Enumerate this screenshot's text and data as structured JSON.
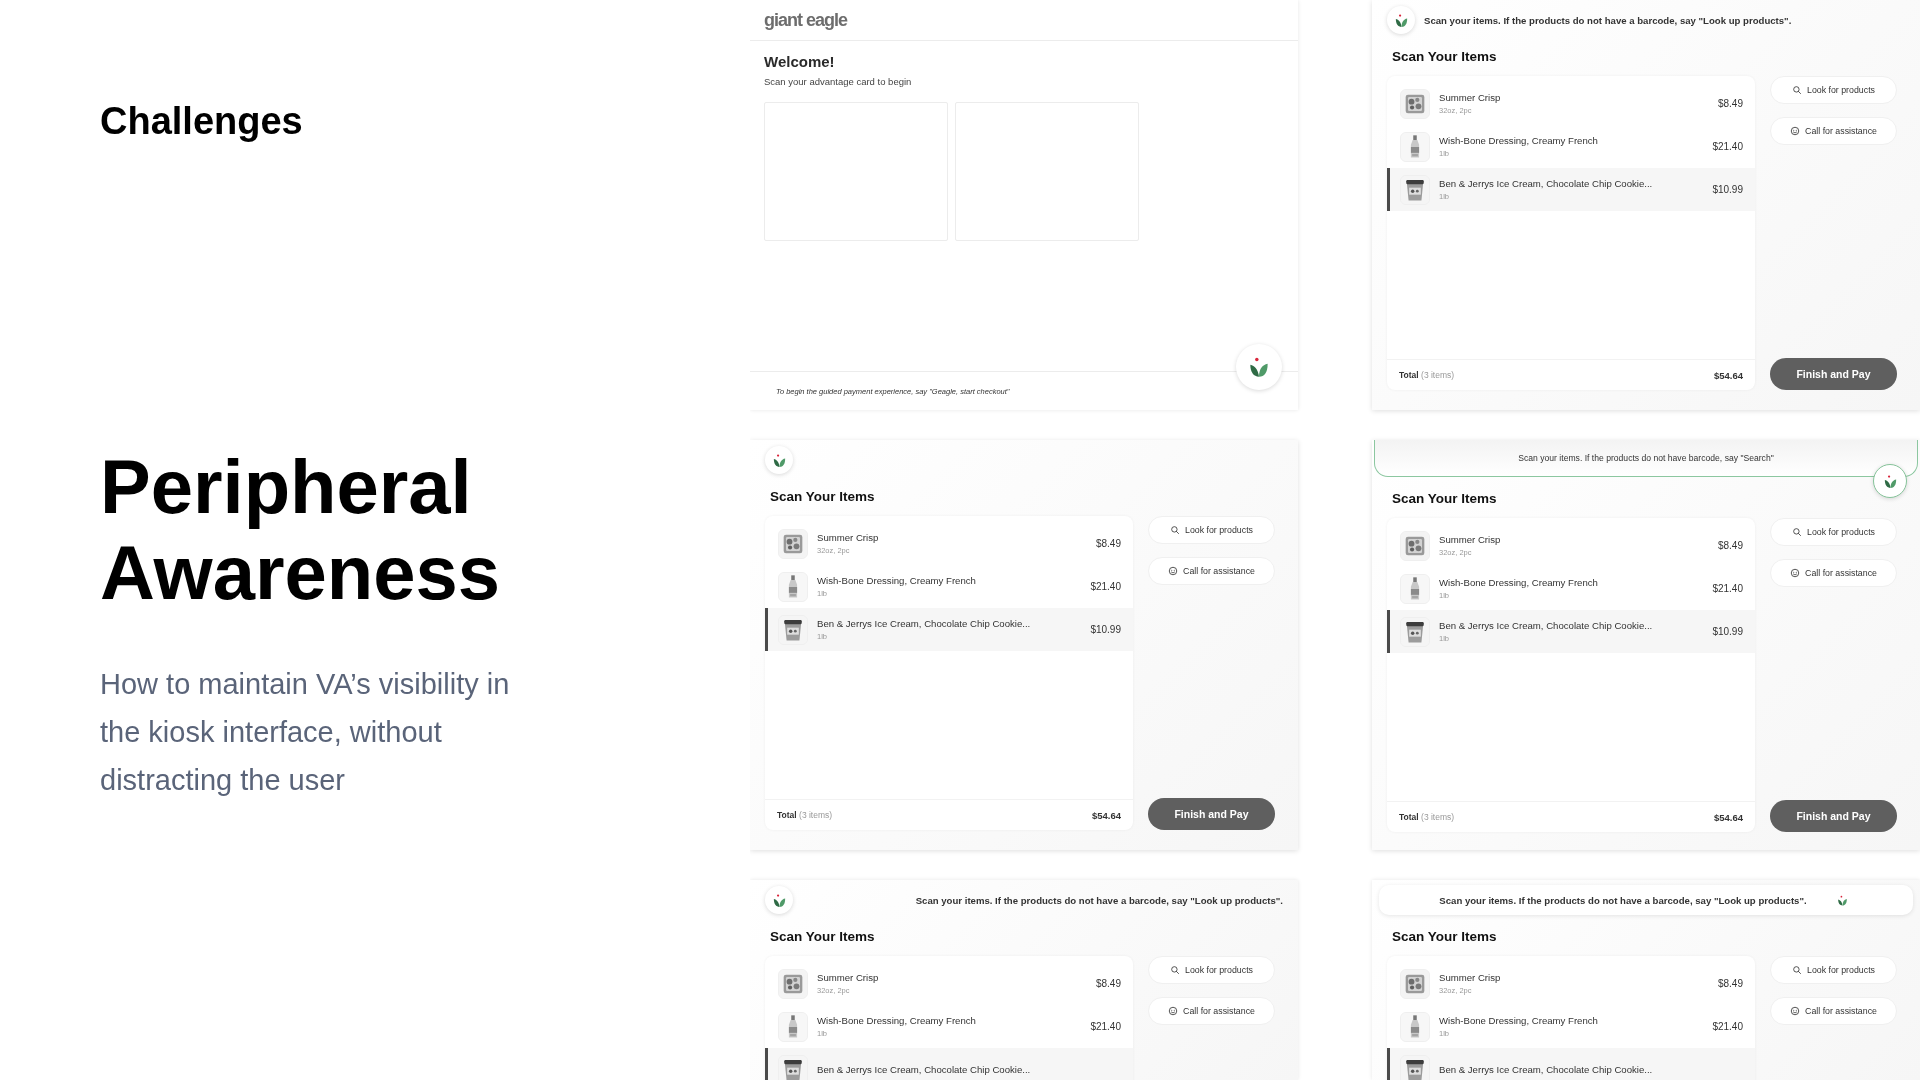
{
  "section_label": "Challenges",
  "title": "Peripheral Awareness",
  "description": "How to maintain VA’s visibility in the kiosk interface, without distracting the user",
  "screens": [
    {
      "kind": "welcome",
      "logo": "giant eagle",
      "heading": "Welcome!",
      "subheading": "Scan your advantage card to begin",
      "footer": "To begin the guided payment experience, say \"Geagle, start checkout\""
    },
    {
      "kind": "scan",
      "assistant": {
        "kind": "inline_left",
        "message": "Scan your items. If the products do not have a barcode, say \"Look up products\"."
      },
      "title": "Scan Your Items",
      "items": [
        {
          "name": "Summer Crisp",
          "detail": "32oz, 2pc",
          "price": "$8.49",
          "selected": false
        },
        {
          "name": "Wish-Bone Dressing, Creamy French",
          "detail": "1lb",
          "price": "$21.40",
          "selected": false
        },
        {
          "name": "Ben & Jerrys Ice Cream, Chocolate Chip Cookie...",
          "detail": "1lb",
          "price": "$10.99",
          "selected": true
        }
      ],
      "total": {
        "label": "Total",
        "count": "(3 items)",
        "amount": "$54.64"
      },
      "actions": [
        {
          "kind": "search",
          "label": "Look for products"
        },
        {
          "kind": "assist",
          "label": "Call for assistance"
        }
      ],
      "primary": "Finish and Pay"
    },
    {
      "kind": "scan",
      "assistant": {
        "kind": "icon_only"
      },
      "title": "Scan Your Items",
      "items": [
        {
          "name": "Summer Crisp",
          "detail": "32oz, 2pc",
          "price": "$8.49",
          "selected": false
        },
        {
          "name": "Wish-Bone Dressing, Creamy French",
          "detail": "1lb",
          "price": "$21.40",
          "selected": false
        },
        {
          "name": "Ben & Jerrys Ice Cream, Chocolate Chip Cookie...",
          "detail": "1lb",
          "price": "$10.99",
          "selected": true
        }
      ],
      "total": {
        "label": "Total",
        "count": "(3 items)",
        "amount": "$54.64"
      },
      "actions": [
        {
          "kind": "search",
          "label": "Look for products"
        },
        {
          "kind": "assist",
          "label": "Call for assistance"
        }
      ],
      "primary": "Finish and Pay"
    },
    {
      "kind": "scan",
      "assistant": {
        "kind": "bubble_right",
        "message": "Scan your items. If the products do not have barcode, say \"Search\""
      },
      "title": "Scan Your Items",
      "items": [
        {
          "name": "Summer Crisp",
          "detail": "32oz, 2pc",
          "price": "$8.49",
          "selected": false
        },
        {
          "name": "Wish-Bone Dressing, Creamy French",
          "detail": "1lb",
          "price": "$21.40",
          "selected": false
        },
        {
          "name": "Ben & Jerrys Ice Cream, Chocolate Chip Cookie...",
          "detail": "1lb",
          "price": "$10.99",
          "selected": true
        }
      ],
      "total": {
        "label": "Total",
        "count": "(3 items)",
        "amount": "$54.64"
      },
      "actions": [
        {
          "kind": "search",
          "label": "Look for products"
        },
        {
          "kind": "assist",
          "label": "Call for assistance"
        }
      ],
      "primary": "Finish and Pay"
    },
    {
      "kind": "scan",
      "assistant": {
        "kind": "split",
        "message": "Scan your items. If the products do not have a barcode, say \"Look up products\"."
      },
      "title": "Scan Your Items",
      "items": [
        {
          "name": "Summer Crisp",
          "detail": "32oz, 2pc",
          "price": "$8.49",
          "selected": false
        },
        {
          "name": "Wish-Bone Dressing, Creamy French",
          "detail": "1lb",
          "price": "$21.40",
          "selected": false
        },
        {
          "name": "Ben & Jerrys Ice Cream, Chocolate Chip Cookie...",
          "selected": true
        }
      ],
      "actions": [
        {
          "kind": "search",
          "label": "Look for products"
        },
        {
          "kind": "assist",
          "label": "Call for assistance"
        }
      ]
    },
    {
      "kind": "scan",
      "assistant": {
        "kind": "bar_trailing",
        "message": "Scan your items. If the products do not have a barcode, say \"Look up products\"."
      },
      "title": "Scan Your Items",
      "items": [
        {
          "name": "Summer Crisp",
          "detail": "32oz, 2pc",
          "price": "$8.49",
          "selected": false
        },
        {
          "name": "Wish-Bone Dressing, Creamy French",
          "detail": "1lb",
          "price": "$21.40",
          "selected": false
        },
        {
          "name": "Ben & Jerrys Ice Cream, Chocolate Chip Cookie...",
          "selected": true
        }
      ],
      "actions": [
        {
          "kind": "search",
          "label": "Look for products"
        },
        {
          "kind": "assist",
          "label": "Call for assistance"
        }
      ]
    }
  ]
}
